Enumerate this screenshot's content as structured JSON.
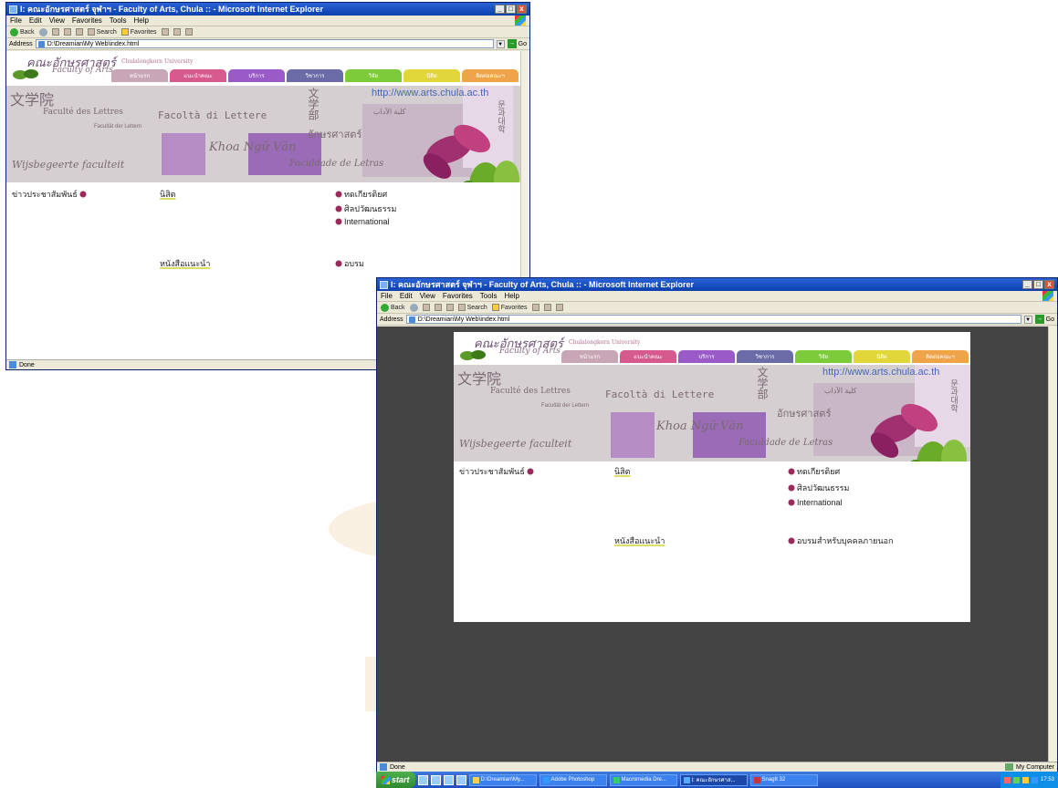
{
  "window1": {
    "title": "I: คณะอักษรศาสตร์ จุฬาฯ - Faculty of Arts, Chula :: - Microsoft Internet Explorer",
    "menu": [
      "File",
      "Edit",
      "View",
      "Favorites",
      "Tools",
      "Help"
    ],
    "toolbar": {
      "back": "Back",
      "search": "Search",
      "favorites": "Favorites"
    },
    "address_label": "Address",
    "address_value": "D:\\Dreamian\\My Web\\index.html",
    "go_label": "Go",
    "status": "Done"
  },
  "window2": {
    "title": "I: คณะอักษรศาสตร์ จุฬาฯ - Faculty of Arts, Chula :: - Microsoft Internet Explorer",
    "menu": [
      "File",
      "Edit",
      "View",
      "Favorites",
      "Tools",
      "Help"
    ],
    "toolbar": {
      "back": "Back",
      "search": "Search",
      "favorites": "Favorites"
    },
    "address_label": "Address",
    "address_value": "D:\\Dreamian\\My Web\\index.html",
    "go_label": "Go",
    "status": "Done",
    "zone": "My Computer"
  },
  "site": {
    "logo_thai": "คณะอักษรศาสตร์",
    "logo_en": "Faculty of Arts",
    "logo_univ": "Chulalongkorn University",
    "tabs": [
      {
        "label": "หน้าแรก",
        "color": "#c9a6b6"
      },
      {
        "label": "แนะนำคณะ",
        "color": "#d65a8e"
      },
      {
        "label": "บริการ",
        "color": "#9a5ac8"
      },
      {
        "label": "วิชาการ",
        "color": "#6b6ba8"
      },
      {
        "label": "วิจัย",
        "color": "#7ccb3a"
      },
      {
        "label": "นิสิต",
        "color": "#e1d63a"
      },
      {
        "label": "ติดต่อคณะฯ",
        "color": "#f0a44a"
      }
    ],
    "banner": {
      "kanji": "文学院",
      "french": "Faculté des Lettres",
      "italian": "Facoltà di Lettere",
      "german": "Facultät der Lettern",
      "japanese": "文学部",
      "url": "http://www.arts.chula.ac.th",
      "arabic": "كلية الآداب",
      "thai": "อักษรศาสตร์",
      "khmer": "Khoa Ngữ Văn",
      "korean": "문과대학",
      "dutch": "Wijsbegeerte faculteit",
      "portuguese": "Faculdade de Letras"
    },
    "links": {
      "news": "ข่าวประชาสัมพันธ์",
      "students": "นิสิต",
      "recommended_books": "หนังสือแนะนำ",
      "alumni": "ทดเกียรติยศ",
      "arts_culture": "ศิลปวัฒนธรรม",
      "international": "International",
      "training": "อบรมสำหรับบุคคลภายนอก",
      "training_short": "อบรม"
    }
  },
  "taskbar": {
    "start": "start",
    "tasks": [
      {
        "label": "D:\\Dreamian\\My..."
      },
      {
        "label": "Adobe Photoshop"
      },
      {
        "label": "Macromedia Dre..."
      },
      {
        "label": "I: คณะอักษรศาส..."
      },
      {
        "label": "SnagIt 32"
      }
    ],
    "clock": "17:53"
  }
}
